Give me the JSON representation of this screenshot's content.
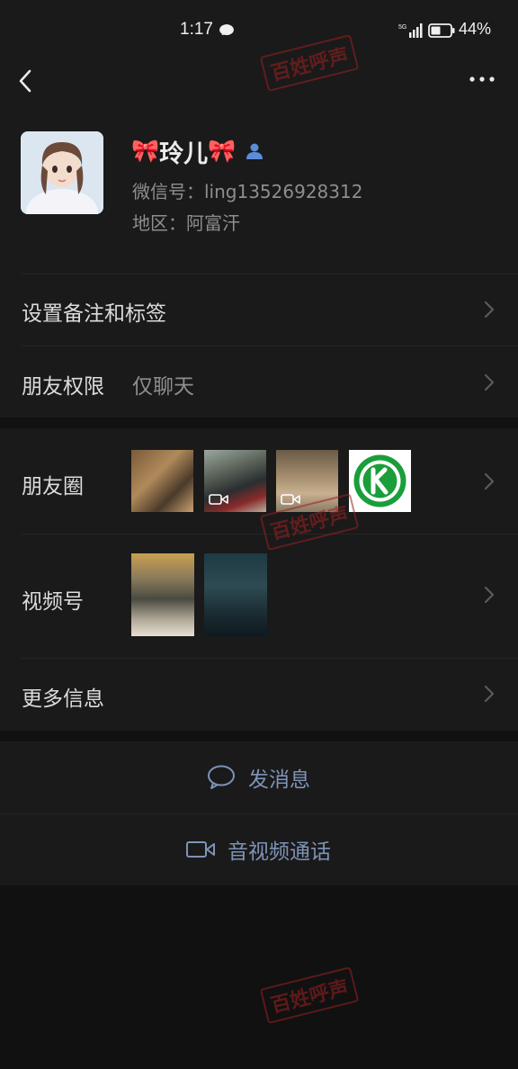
{
  "status_bar": {
    "time": "1:17",
    "battery": "44%"
  },
  "profile": {
    "nickname": "玲儿",
    "bow_glyph": "🎀",
    "wechat_id": "微信号：ling13526928312",
    "region": "地区：阿富汗"
  },
  "rows": {
    "remark_tags": "设置备注和标签",
    "friend_permission_label": "朋友权限",
    "friend_permission_value": "仅聊天",
    "moments_label": "朋友圈",
    "channels_label": "视频号",
    "more_info": "更多信息"
  },
  "actions": {
    "send_message": "发消息",
    "av_call": "音视频通话"
  },
  "watermark": {
    "text": "百姓呼声"
  },
  "colors": {
    "background": "#111111",
    "panel": "#1a1a1a",
    "action_text": "#7d93b7",
    "moments_logo_green": "#1a9e3a"
  }
}
